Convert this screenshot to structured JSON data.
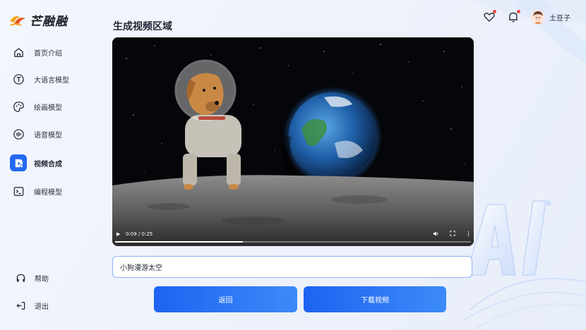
{
  "app": {
    "logo_text": "芒融融"
  },
  "sidebar": {
    "items": [
      {
        "label": "首页介绍",
        "icon": "home-icon"
      },
      {
        "label": "大语言模型",
        "icon": "text-model-icon"
      },
      {
        "label": "绘画模型",
        "icon": "palette-icon"
      },
      {
        "label": "语音模型",
        "icon": "voice-icon"
      },
      {
        "label": "视频合成",
        "icon": "video-icon",
        "active": true
      },
      {
        "label": "编程模型",
        "icon": "terminal-icon"
      }
    ],
    "help_label": "帮助",
    "logout_label": "退出"
  },
  "header": {
    "title": "生成视频区域",
    "user_name": "土豆子"
  },
  "video": {
    "time_display": "0:09 / 0:25",
    "progress": 0.36
  },
  "prompt": {
    "value": "小狗漫游太空"
  },
  "actions": {
    "back_label": "返回",
    "download_label": "下载视频"
  },
  "colors": {
    "accent": "#2468f2",
    "notification": "#f04848"
  }
}
